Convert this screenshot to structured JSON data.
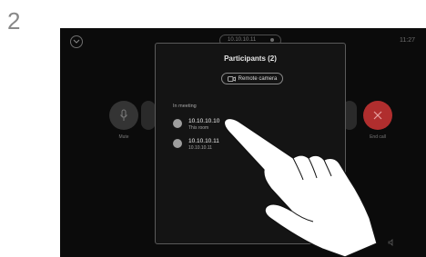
{
  "step_number": "2",
  "screen": {
    "top_pill_text": "10.10.10.11",
    "clock": "11:27",
    "mute_label": "Mute",
    "end_call_label": "End call"
  },
  "panel": {
    "title": "Participants (2)",
    "remote_camera_label": "Remote camera",
    "section_label": "In meeting",
    "participants": [
      {
        "name": "10.10.10.10",
        "subtitle": "This room"
      },
      {
        "name": "10.10.10.11",
        "subtitle": "10.10.10.11"
      }
    ]
  },
  "colors": {
    "screen_bg": "#0b0b0b",
    "panel_bg": "#141414",
    "end_call_red": "#b02e2e",
    "hand_white": "#ffffff"
  },
  "icons": {
    "top_left": "chevron-down-icon",
    "mute": "microphone-icon",
    "end_call": "close-icon",
    "remote_camera": "camera-icon",
    "volume": "speaker-icon"
  }
}
